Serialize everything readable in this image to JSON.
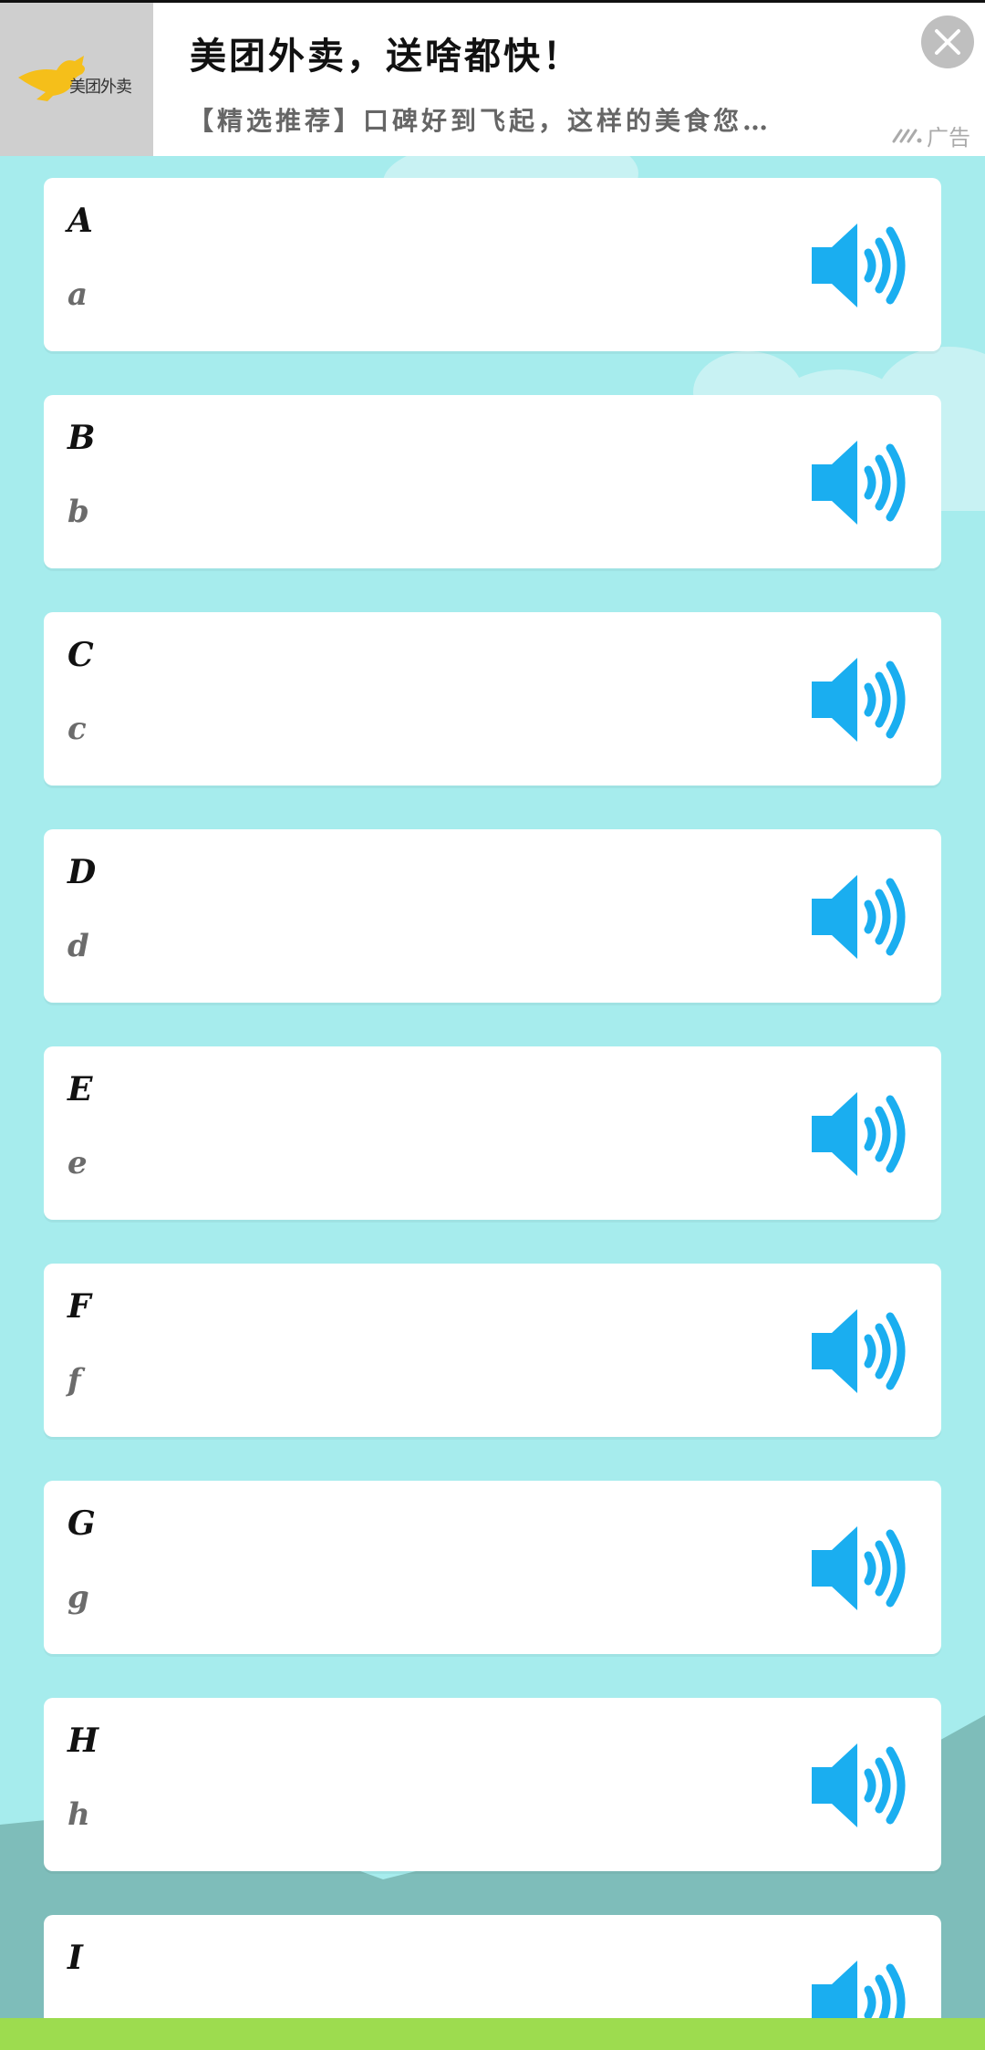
{
  "ad": {
    "logo_text": "美团外卖",
    "title": "美团外卖，送啥都快！",
    "description": "【精选推荐】口碑好到飞起，这样的美食您…",
    "label": "广告",
    "close_icon": "close-icon",
    "ad_mark_icon": "ad-brand-icon"
  },
  "letters": [
    {
      "upper": "A",
      "lower": "a"
    },
    {
      "upper": "B",
      "lower": "b"
    },
    {
      "upper": "C",
      "lower": "c"
    },
    {
      "upper": "D",
      "lower": "d"
    },
    {
      "upper": "E",
      "lower": "e"
    },
    {
      "upper": "F",
      "lower": "f"
    },
    {
      "upper": "G",
      "lower": "g"
    },
    {
      "upper": "H",
      "lower": "h"
    },
    {
      "upper": "I",
      "lower": ""
    }
  ],
  "colors": {
    "background": "#a6eced",
    "speaker": "#1aaef0",
    "hill": "#7ebdba",
    "grass": "#9ddc4f"
  },
  "icons": {
    "speaker": "speaker-icon"
  }
}
